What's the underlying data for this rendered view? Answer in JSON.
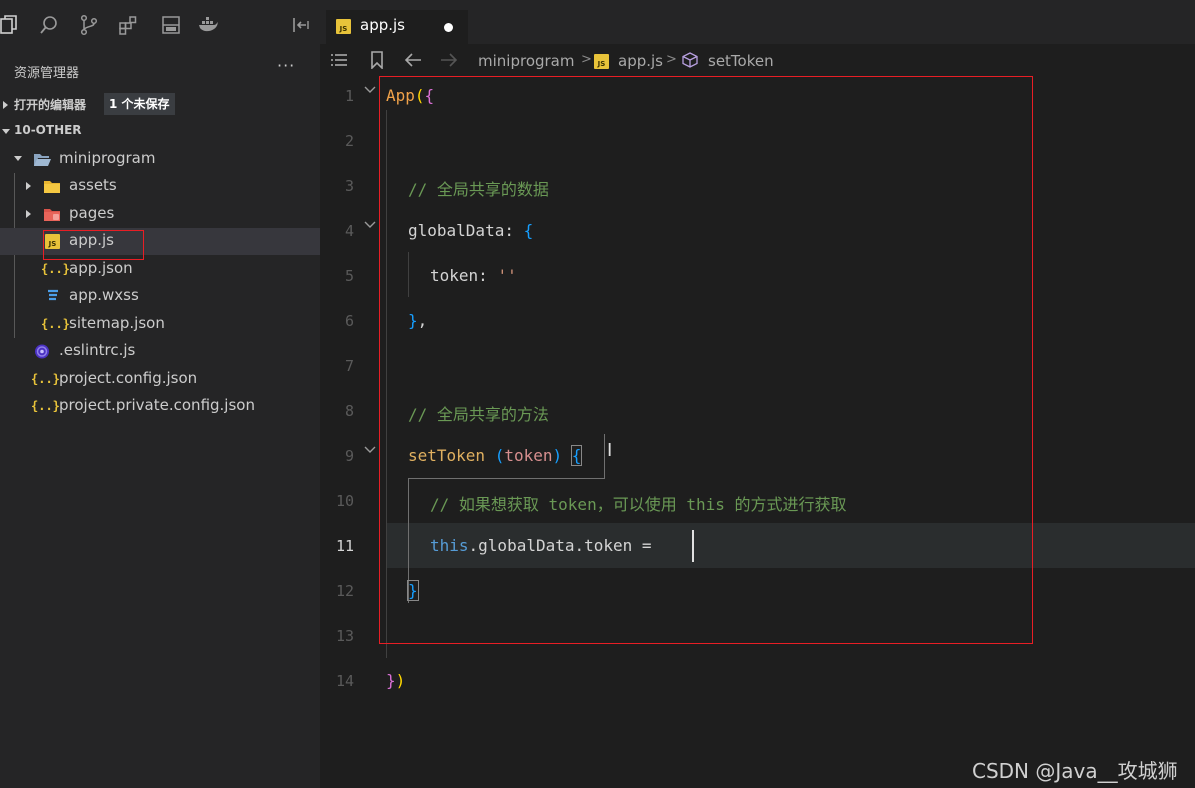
{
  "toolbar": {
    "icons": [
      "explorer-icon",
      "search-icon",
      "source-control-icon",
      "extensions-icon",
      "panel-icon",
      "docker-icon",
      "collapse-panel-icon"
    ]
  },
  "sidebar": {
    "title": "资源管理器",
    "more": "···",
    "open_editors_label": "打开的编辑器",
    "unsaved_badge": "1 个未保存",
    "workspace_label": "10-OTHER",
    "tree": [
      {
        "label": "miniprogram",
        "type": "folder-open"
      },
      {
        "label": "assets",
        "type": "folder"
      },
      {
        "label": "pages",
        "type": "folder-pages"
      },
      {
        "label": "app.js",
        "type": "js",
        "selected": true
      },
      {
        "label": "app.json",
        "type": "json"
      },
      {
        "label": "app.wxss",
        "type": "css"
      },
      {
        "label": "sitemap.json",
        "type": "json"
      },
      {
        "label": ".eslintrc.js",
        "type": "eslint"
      },
      {
        "label": "project.config.json",
        "type": "json"
      },
      {
        "label": "project.private.config.json",
        "type": "json"
      }
    ]
  },
  "tab": {
    "label": "app.js",
    "icon_text": "JS"
  },
  "breadcrumb": {
    "folder": "miniprogram",
    "file": "app.js",
    "symbol": "setToken"
  },
  "editor": {
    "line_numbers": [
      "1",
      "2",
      "3",
      "4",
      "5",
      "6",
      "7",
      "8",
      "9",
      "10",
      "11",
      "12",
      "13",
      "14"
    ],
    "active_line": "11",
    "code": {
      "l1_fn": "App",
      "l1_paren": "(",
      "l1_brace": "{",
      "l3_comment": "// 全局共享的数据",
      "l4_prop": "globalData",
      "l4_colon": ": ",
      "l4_brace": "{",
      "l5_prop": "token",
      "l5_colon": ": ",
      "l5_str": "''",
      "l6_brace": "}",
      "l6_comma": ",",
      "l8_comment": "// 全局共享的方法",
      "l9_method": "setToken",
      "l9_space": " ",
      "l9_lparen": "(",
      "l9_param": "token",
      "l9_rparen": ")",
      "l9_brace": "{",
      "l10_comment": "// 如果想获取 token，可以使用 this 的方式进行获取",
      "l11_this": "this",
      "l11_rest": ".globalData.token",
      "l11_eq": " =",
      "l12_brace": "}",
      "l14_brace": "}",
      "l14_paren": ")"
    }
  },
  "watermark": "CSDN @Java__攻城狮",
  "colors": {
    "highlight_border": "#e81e25",
    "js_badge": "#e8c33a"
  }
}
